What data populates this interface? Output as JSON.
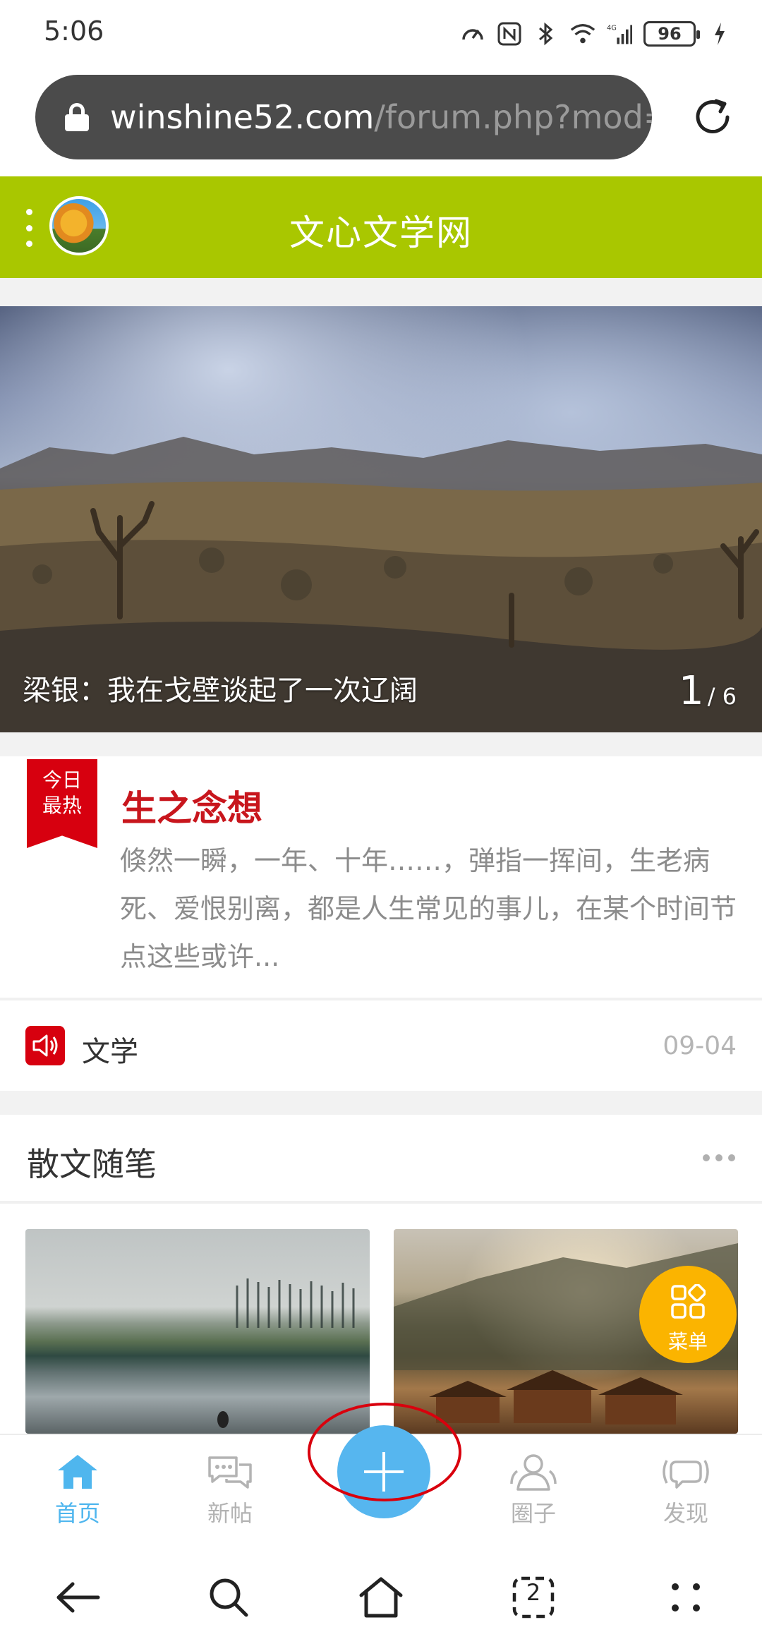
{
  "status_bar": {
    "time": "5:06",
    "battery": "96"
  },
  "browser": {
    "url_host": "winshine52.com",
    "url_path": "/forum.php?mod=g",
    "tab_count": "2"
  },
  "site": {
    "title": "文心文学网",
    "header_color": "#a9c700"
  },
  "banner": {
    "caption": "梁银：我在戈壁谈起了一次辽阔",
    "current": "1",
    "total": "/ 6"
  },
  "hot": {
    "ribbon_line1": "今日",
    "ribbon_line2": "最热",
    "title": "生之念想",
    "excerpt": "倏然一瞬，一年、十年……，弹指一挥间，生老病死、爱恨别离，都是人生常见的事儿，在某个时间节点这些或许..."
  },
  "notice": {
    "label": "文学",
    "date": "09-04"
  },
  "section": {
    "title": "散文随笔"
  },
  "menu_fab": {
    "label": "菜单"
  },
  "tabbar": {
    "tabs": [
      {
        "label": "首页",
        "icon": "home-icon",
        "active": true
      },
      {
        "label": "新帖",
        "icon": "chat-bubbles-icon",
        "active": false
      },
      {
        "label": "圈子",
        "icon": "group-icon",
        "active": false
      },
      {
        "label": "发现",
        "icon": "broadcast-icon",
        "active": false
      }
    ],
    "active_color": "#4fb6ee",
    "fab_color": "#56b6ef"
  },
  "system_nav": {
    "buttons": [
      "back-icon",
      "search-icon",
      "home-icon",
      "tabs-icon",
      "more-icon"
    ]
  }
}
